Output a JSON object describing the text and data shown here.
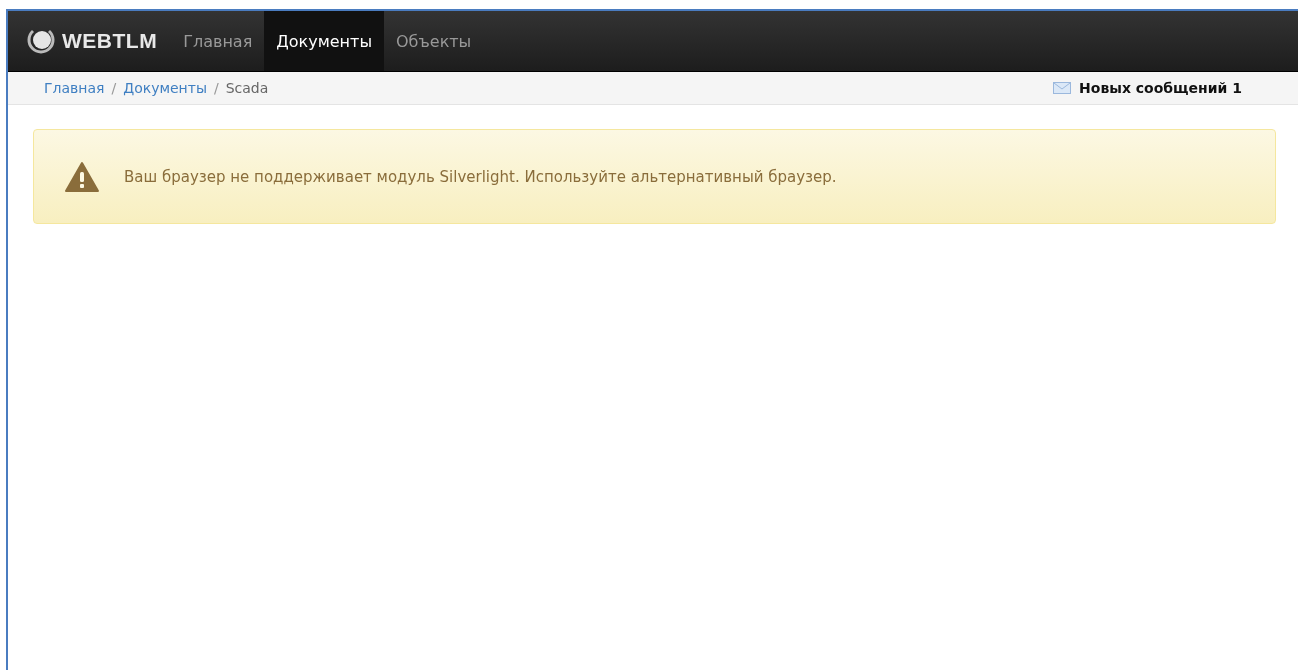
{
  "navbar": {
    "brand": "WEBTLM",
    "items": [
      {
        "label": "Главная",
        "selected": false
      },
      {
        "label": "Документы",
        "selected": true
      },
      {
        "label": "Объекты",
        "selected": false
      }
    ]
  },
  "breadcrumb": [
    {
      "label": "Главная",
      "kind": "link"
    },
    {
      "label": "Документы",
      "kind": "link"
    },
    {
      "label": "Scada",
      "kind": "current"
    }
  ],
  "breadcrumb_separator": "/",
  "messages": {
    "label": "Новых сообщений 1"
  },
  "alert": {
    "text": "Ваш браузер не поддерживает модуль Silverlight. Используйте альтернативный браузер."
  }
}
